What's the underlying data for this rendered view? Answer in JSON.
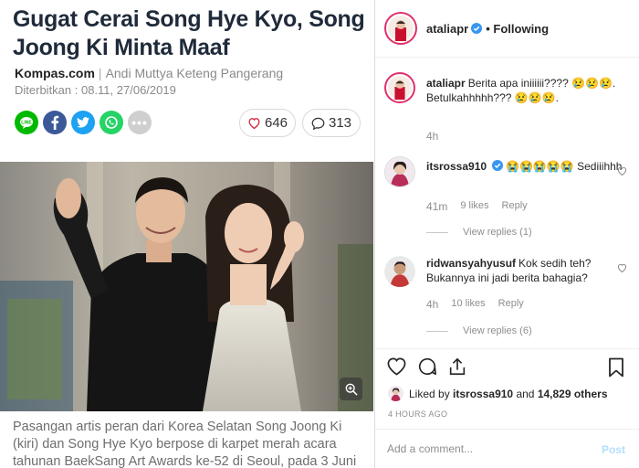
{
  "article": {
    "headline": "Gugat Cerai Song Hye Kyo, Song Joong Ki Minta Maaf",
    "source": "Kompas.com",
    "author": "Andi Muttya Keteng Pangerang",
    "published": "Diterbitkan : 08.11, 27/06/2019",
    "share_icons": [
      "line-icon",
      "facebook-icon",
      "twitter-icon",
      "whatsapp-icon",
      "more-icon"
    ],
    "like_count": "646",
    "comment_count": "313",
    "caption": "Pasangan artis peran dari Korea Selatan Song Joong Ki (kiri) dan Song Hye Kyo berpose di karpet merah acara tahunan BaekSang Art Awards ke-52 di Seoul, pada 3 Juni"
  },
  "instagram": {
    "post_user": "ataliapr",
    "following_label": "• Following",
    "comments": [
      {
        "username": "ataliapr",
        "text": "Berita apa iniiiiii???? 😢😢😢. Betulkahhhhh??? 😢😢😢.",
        "time": "4h"
      },
      {
        "username": "itsrossa910",
        "text": "😭😭😭😭😭 Sediiihhh",
        "time": "41m",
        "likes": "9 likes",
        "reply": "Reply",
        "view_replies": "View replies (1)"
      },
      {
        "username": "ridwansyahyusuf",
        "text": "Kok sedih teh? Bukannya ini jadi berita bahagia?",
        "time": "4h",
        "likes": "10 likes",
        "reply": "Reply",
        "view_replies": "View replies (6)"
      }
    ],
    "liked_by_user": "itsrossa910",
    "liked_by_and": "and",
    "liked_by_others": "14,829 others",
    "liked_by_prefix": "Liked by",
    "timestamp": "4 HOURS AGO",
    "add_comment_placeholder": "Add a comment...",
    "post_label": "Post",
    "colors": {
      "verified": "#3897f0",
      "post_disabled": "#b2dffc",
      "story_ring": "#e1306c"
    }
  }
}
